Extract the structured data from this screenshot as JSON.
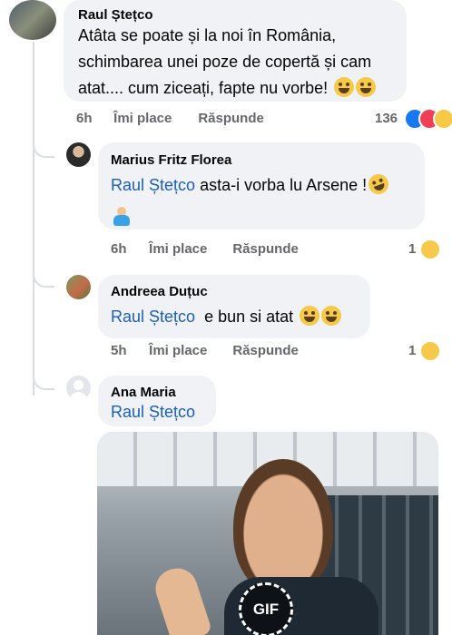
{
  "comments": [
    {
      "author": "Raul Ștețco",
      "text_lines": [
        "Atâta se poate și la noi în România,",
        "schimbarea unei poze de copertă și cam",
        "atat.... cum ziceați, fapte nu vorbe! "
      ],
      "time": "6h",
      "like": "Îmi place",
      "reply": "Răspunde",
      "reaction_count": "136",
      "reactions": [
        "like",
        "love",
        "haha"
      ],
      "emojis": [
        "grinning-sweat",
        "grinning-sweat"
      ]
    },
    {
      "author": "Marius Fritz Florea",
      "mention": "Raul Ștețco",
      "text": " asta-i vorba lu Arsene !",
      "emojis": [
        "rofl",
        "person-shrugging"
      ],
      "time": "6h",
      "like": "Îmi place",
      "reply": "Răspunde",
      "reaction_count": "1",
      "reactions": [
        "haha"
      ]
    },
    {
      "author": "Andreea Duțuc",
      "mention": "Raul Ștețco",
      "text": "  e bun si atat ",
      "emojis": [
        "joy",
        "joy"
      ],
      "time": "5h",
      "like": "Îmi place",
      "reply": "Răspunde",
      "reaction_count": "1",
      "reactions": [
        "haha"
      ]
    },
    {
      "author": "Ana Maria",
      "mention": "Raul Ștețco",
      "gif_badge": "GIF"
    }
  ],
  "colors": {
    "mention": "#1a5fb4",
    "bubble": "#f0f2f5",
    "meta": "#65676b",
    "like_blue": "#1877f2",
    "love_red": "#f33e58",
    "haha_yellow": "#f7c948"
  }
}
